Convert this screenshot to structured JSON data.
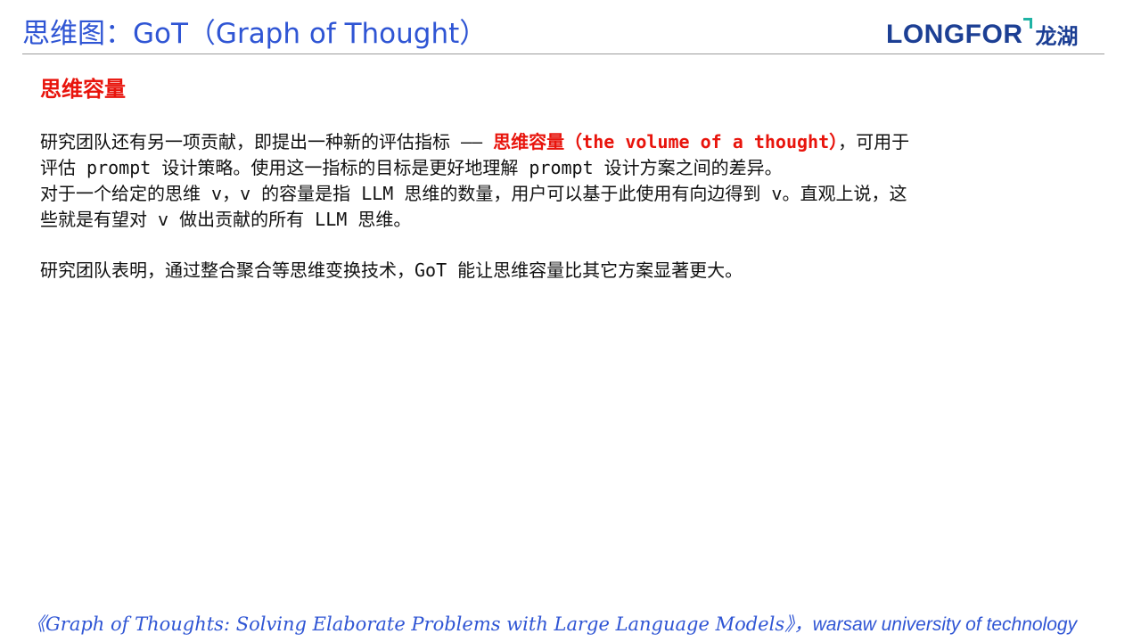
{
  "header": {
    "title": "思维图：GoT（Graph of Thought）",
    "logo_en": "LONGFOR",
    "logo_cn": "龙湖"
  },
  "section": {
    "heading": "思维容量",
    "para1_prefix": "研究团队还有另一项贡献，即提出一种新的评估指标 —— ",
    "para1_highlight": "思维容量（the volume of a thought）",
    "para1_suffix": "，可用于",
    "para1_line2": "评估 prompt 设计策略。使用这一指标的目标是更好地理解 prompt 设计方案之间的差异。",
    "para2_line1": "对于一个给定的思维 v，v 的容量是指 LLM 思维的数量，用户可以基于此使用有向边得到 v。直观上说，这",
    "para2_line2": "些就是有望对 v 做出贡献的所有 LLM 思维。",
    "para3": "研究团队表明，通过整合聚合等思维变换技术，GoT 能让思维容量比其它方案显著更大。"
  },
  "footer": {
    "reference": "《Graph of Thoughts: Solving Elaborate Problems with Large Language Models》，",
    "source": "warsaw university of technology"
  },
  "colors": {
    "title": "#2f55d4",
    "accent_red": "#e8140c",
    "logo_blue": "#1c3f94",
    "logo_teal": "#1fb3a4"
  }
}
